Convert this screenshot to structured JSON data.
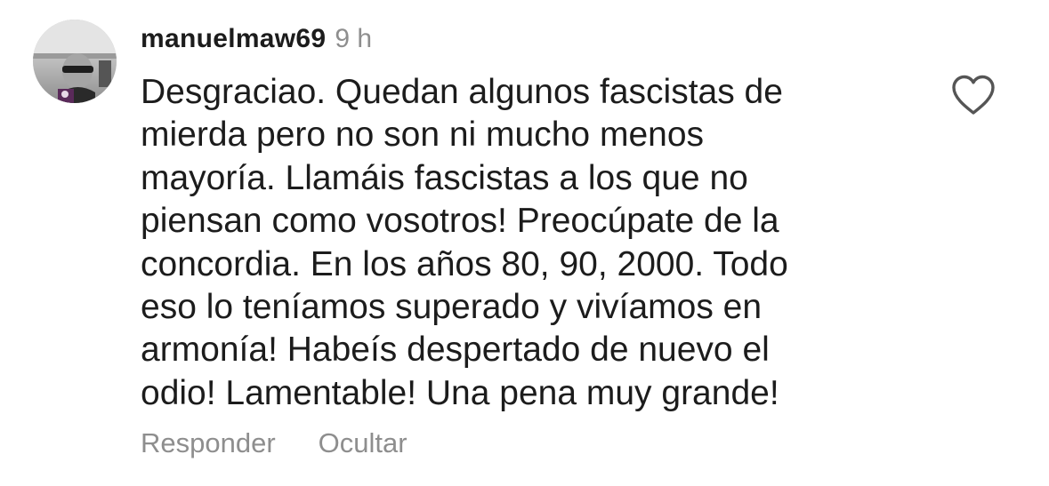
{
  "comment": {
    "avatar_icon": "user-avatar-photo",
    "username": "manuelmaw69",
    "time": "9 h",
    "text": "Desgraciao. Quedan algunos fascistas de\nmierda pero no son ni mucho menos\nmayoría. Llamáis fascistas a los que no\npiensan como vosotros! Preocúpate de la\nconcordia. En los años 80, 90, 2000. Todo\neso lo teníamos superado y vivíamos en\narmonía! Habeís despertado de nuevo el\nodio! Lamentable! Una pena muy grande!",
    "actions": {
      "reply_label": "Responder",
      "hide_label": "Ocultar"
    },
    "like_icon": "heart-outline-icon"
  },
  "colors": {
    "text": "#1c1c1c",
    "secondary": "#8e8e8e",
    "background": "#ffffff"
  }
}
